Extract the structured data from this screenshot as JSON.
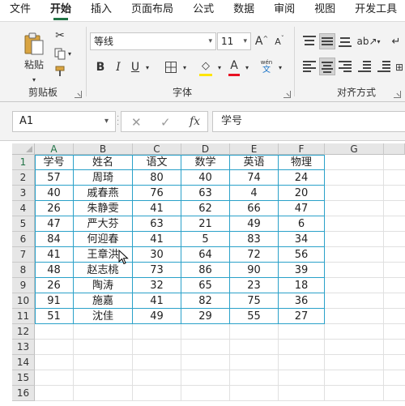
{
  "menu": {
    "tabs": [
      "文件",
      "开始",
      "插入",
      "页面布局",
      "公式",
      "数据",
      "审阅",
      "视图",
      "开发工具"
    ],
    "active": 1
  },
  "ribbon": {
    "clipboard": {
      "label": "剪贴板",
      "paste_label": "粘贴"
    },
    "font": {
      "label": "字体",
      "font_name": "等线",
      "font_size": "11",
      "bold": "B",
      "italic": "I",
      "underline": "U",
      "grow": "A",
      "shrink": "A",
      "font_color_glyph": "A",
      "wen_top": "wén",
      "wen_bottom": "文",
      "highlight_color": "#ffe500",
      "font_color": "#e81123"
    },
    "alignment": {
      "label": "对齐方式"
    }
  },
  "formula_bar": {
    "name_box": "A1",
    "cancel": "✕",
    "confirm": "✓",
    "fx": "fx",
    "content": "学号"
  },
  "sheet": {
    "columns": [
      "A",
      "B",
      "C",
      "D",
      "E",
      "F",
      "G"
    ],
    "row_numbers": [
      "1",
      "2",
      "3",
      "4",
      "5",
      "6",
      "7",
      "8",
      "9",
      "10",
      "11",
      "12",
      "13",
      "14",
      "15",
      "16"
    ],
    "header": [
      "学号",
      "姓名",
      "语文",
      "数学",
      "英语",
      "物理"
    ],
    "rows": [
      [
        "57",
        "周琦",
        "80",
        "40",
        "74",
        "24"
      ],
      [
        "40",
        "戚春燕",
        "76",
        "63",
        "4",
        "20"
      ],
      [
        "26",
        "朱静雯",
        "41",
        "62",
        "66",
        "47"
      ],
      [
        "47",
        "严大芬",
        "63",
        "21",
        "49",
        "6"
      ],
      [
        "84",
        "何迎春",
        "41",
        "5",
        "83",
        "34"
      ],
      [
        "41",
        "王章洪",
        "30",
        "64",
        "72",
        "56"
      ],
      [
        "48",
        "赵志桃",
        "73",
        "86",
        "90",
        "39"
      ],
      [
        "26",
        "陶涛",
        "32",
        "65",
        "23",
        "18"
      ],
      [
        "91",
        "施嘉",
        "41",
        "82",
        "75",
        "36"
      ],
      [
        "51",
        "沈佳",
        "49",
        "29",
        "55",
        "27"
      ]
    ],
    "border_color": "#2aa1c9"
  }
}
